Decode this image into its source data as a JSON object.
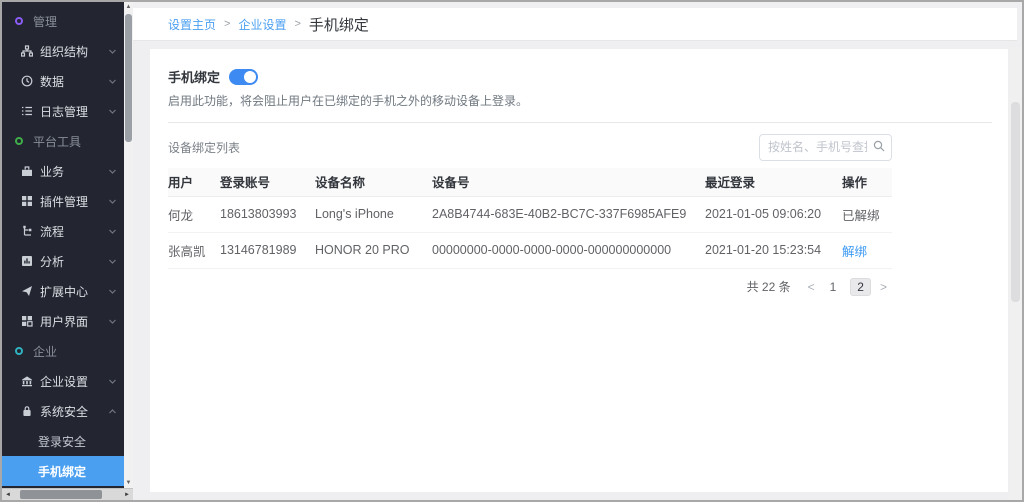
{
  "sidebar": {
    "items": [
      {
        "type": "section",
        "label": "管理",
        "icon": "circle-outline-icon",
        "dot_color": "#8b5cf6"
      },
      {
        "type": "item",
        "label": "组织结构",
        "icon": "org-tree-icon",
        "chevron": "down"
      },
      {
        "type": "item",
        "label": "数据",
        "icon": "clock-icon",
        "chevron": "down"
      },
      {
        "type": "item",
        "label": "日志管理",
        "icon": "log-list-icon",
        "chevron": "down"
      },
      {
        "type": "section",
        "label": "平台工具",
        "icon": "circle-outline-icon",
        "dot_color": "#3fae49"
      },
      {
        "type": "item",
        "label": "业务",
        "icon": "briefcase-icon",
        "chevron": "down"
      },
      {
        "type": "item",
        "label": "插件管理",
        "icon": "plugin-grid-icon",
        "chevron": "down"
      },
      {
        "type": "item",
        "label": "流程",
        "icon": "flow-icon",
        "chevron": "down"
      },
      {
        "type": "item",
        "label": "分析",
        "icon": "chart-icon",
        "chevron": "down"
      },
      {
        "type": "item",
        "label": "扩展中心",
        "icon": "expand-center-icon",
        "chevron": "down"
      },
      {
        "type": "item",
        "label": "用户界面",
        "icon": "ui-grid-icon",
        "chevron": "down"
      },
      {
        "type": "section",
        "label": "企业",
        "icon": "circle-outline-icon",
        "dot_color": "#2fb3c0"
      },
      {
        "type": "item",
        "label": "企业设置",
        "icon": "building-icon",
        "chevron": "down"
      },
      {
        "type": "item",
        "label": "系统安全",
        "icon": "lock-icon",
        "chevron": "up"
      },
      {
        "type": "subitem",
        "label": "登录安全",
        "active": false
      },
      {
        "type": "subitem",
        "label": "手机绑定",
        "active": true
      }
    ],
    "active_color": "#4a9ff0"
  },
  "breadcrumb": {
    "links": [
      "设置主页",
      "企业设置"
    ],
    "separator": ">",
    "current": "手机绑定"
  },
  "toggle_section": {
    "label": "手机绑定",
    "state": "on",
    "description": "启用此功能，将会阻止用户在已绑定的手机之外的移动设备上登录。"
  },
  "device_list": {
    "title": "设备绑定列表",
    "search_placeholder": "按姓名、手机号查找用户",
    "columns": [
      "用户",
      "登录账号",
      "设备名称",
      "设备号",
      "最近登录",
      "操作"
    ],
    "rows": [
      {
        "user": "何龙",
        "account": "18613803993",
        "device_name": "Long's iPhone",
        "device_id": "2A8B4744-683E-40B2-BC7C-337F6985AFE9",
        "last_login": "2021-01-05 09:06:20",
        "action": "已解绑",
        "action_is_link": false
      },
      {
        "user": "张高凯",
        "account": "13146781989",
        "device_name": "HONOR 20 PRO",
        "device_id": "00000000-0000-0000-0000-000000000000",
        "last_login": "2021-01-20 15:23:54",
        "action": "解绑",
        "action_is_link": true
      }
    ],
    "pagination": {
      "total_text": "共 22 条",
      "prev": "<",
      "next": ">",
      "pages": [
        "1",
        "2"
      ],
      "active_page": "2"
    }
  },
  "colors": {
    "sidebar_bg": "#232631",
    "active_item": "#4a9ff0",
    "link_blue": "#3d9af2",
    "toggle_on": "#3d8af2"
  }
}
